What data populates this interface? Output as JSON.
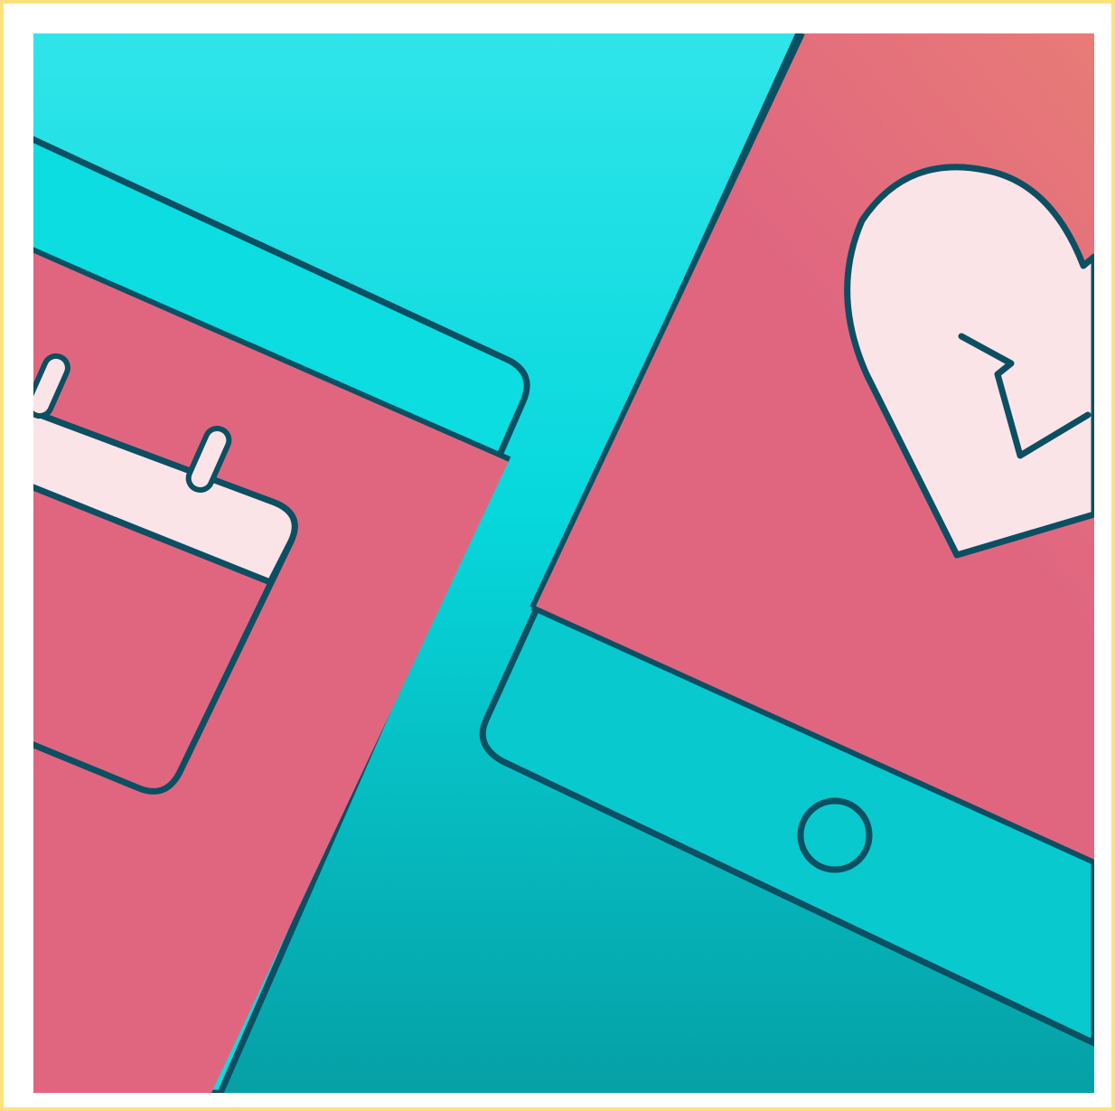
{
  "illustration": {
    "icons": [
      "tablet-icon",
      "calendar-icon",
      "heart-icon",
      "checkmark-icon",
      "home-button-icon"
    ],
    "colors": {
      "background_top": "#2fe5ea",
      "background_mid": "#06d8dc",
      "background_bottom": "#05a0a6",
      "screen": "#e06680",
      "screen_top": "#e87b77",
      "card": "#fbe4e8",
      "outline": "#0b4f62",
      "frame_border": "#fbe27e",
      "frame_inner": "#ffffff"
    }
  }
}
